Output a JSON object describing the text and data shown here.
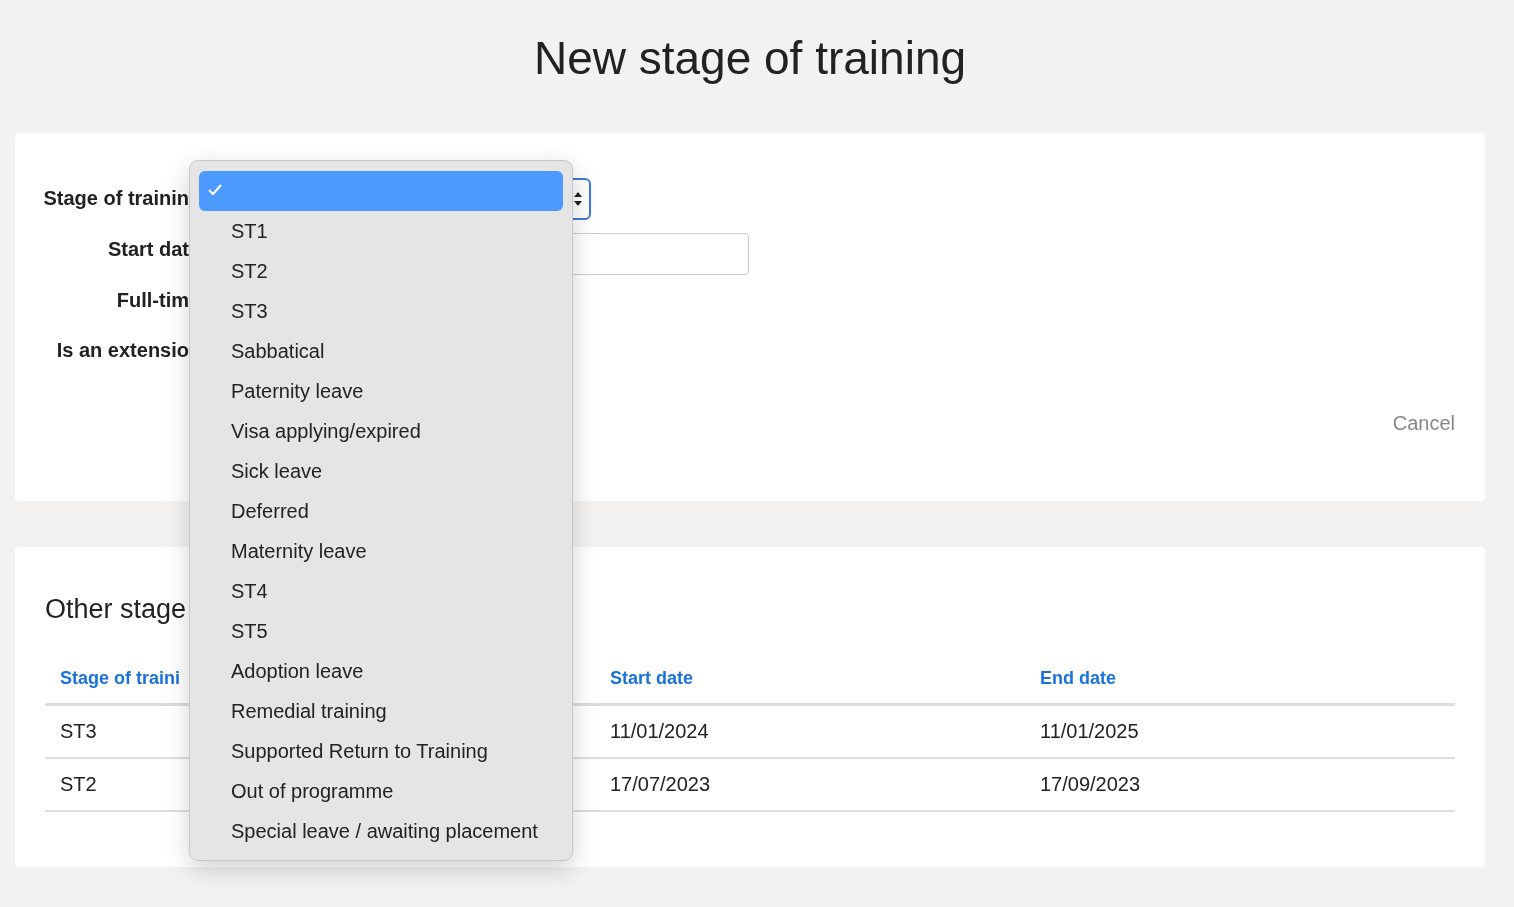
{
  "page": {
    "title": "New stage of training"
  },
  "form": {
    "fields": [
      {
        "label": "Stage of trainin",
        "kind": "select"
      },
      {
        "label": "Start dat",
        "kind": "date"
      },
      {
        "label": "Full-tim",
        "kind": "none"
      },
      {
        "label": "Is an extensio",
        "kind": "none"
      }
    ],
    "cancel": "Cancel"
  },
  "dropdown": {
    "options": [
      {
        "selected": true
      },
      {
        "label": "ST1",
        "selected": false
      },
      {
        "label": "ST2",
        "selected": false
      },
      {
        "label": "ST3",
        "selected": false
      },
      {
        "label": "Sabbatical",
        "selected": false
      },
      {
        "label": "Paternity leave",
        "selected": false
      },
      {
        "label": "Visa applying/expired",
        "selected": false
      },
      {
        "label": "Sick leave",
        "selected": false
      },
      {
        "label": "Deferred",
        "selected": false
      },
      {
        "label": "Maternity leave",
        "selected": false
      },
      {
        "label": "ST4",
        "selected": false
      },
      {
        "label": "ST5",
        "selected": false
      },
      {
        "label": "Adoption leave",
        "selected": false
      },
      {
        "label": "Remedial training",
        "selected": false
      },
      {
        "label": "Supported Return to Training",
        "selected": false
      },
      {
        "label": "Out of programme",
        "selected": false
      },
      {
        "label": "Special leave / awaiting placement",
        "selected": false
      }
    ]
  },
  "other_stages": {
    "title": "Other stage",
    "table": {
      "columns": [
        "Stage of traini",
        "Start date",
        "End date"
      ],
      "rows": [
        [
          "ST3",
          "11/01/2024",
          "11/01/2025"
        ],
        [
          "ST2",
          "17/07/2023",
          "17/09/2023"
        ]
      ]
    }
  }
}
